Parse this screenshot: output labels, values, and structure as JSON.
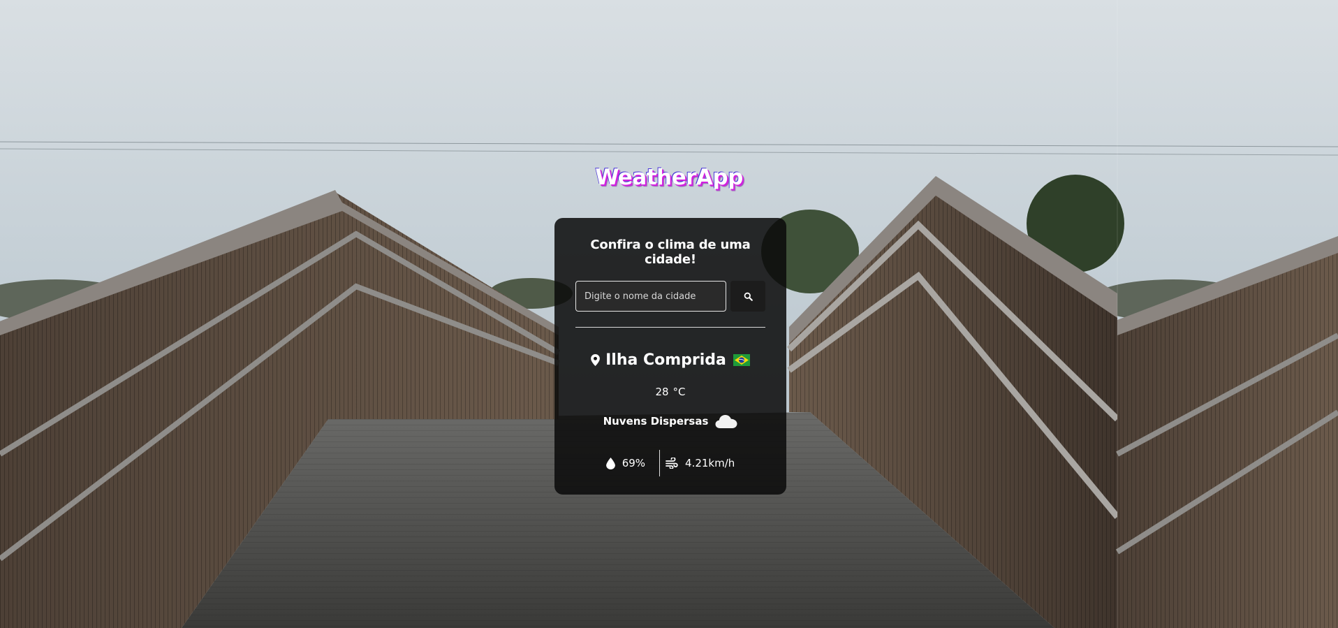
{
  "app": {
    "title": "WeatherApp"
  },
  "card": {
    "heading": "Confira o clima de uma cidade!",
    "search": {
      "placeholder": "Digite o nome da cidade",
      "value": "",
      "button_icon": "search-icon"
    }
  },
  "weather": {
    "city": "Ilha Comprida",
    "country_flag": "brazil-flag-icon",
    "temperature": "28",
    "unit": "°C",
    "description": "Nuvens Dispersas",
    "description_icon": "cloud-icon",
    "humidity": "69%",
    "humidity_icon": "water-drop-icon",
    "wind": "4.21km/h",
    "wind_icon": "wind-icon"
  },
  "colors": {
    "card_background": "#0a0a0a",
    "title_shadow_primary": "#d21ee0",
    "title_shadow_secondary": "#4b35d6",
    "text": "#ffffff"
  }
}
